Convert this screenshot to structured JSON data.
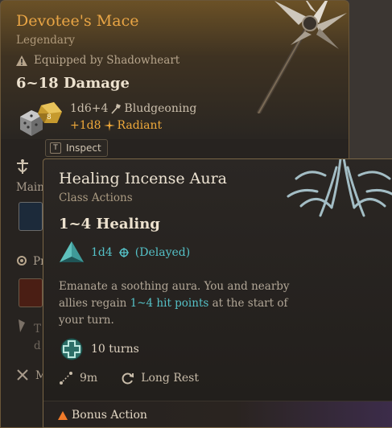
{
  "item": {
    "name": "Devotee's Mace",
    "rarity": "Legendary",
    "equipped_text": "Equipped by Shadowheart",
    "damage_total": "6~18 Damage",
    "damage_rows": [
      {
        "dice": "1d6+4",
        "type": "Bludgeoning"
      },
      {
        "dice": "+1d8",
        "type": "Radiant"
      }
    ],
    "partial_labels": {
      "main": "Main",
      "proficiency": "Pr",
      "t_row": "T",
      "d_row": "d",
      "m_row": "M"
    }
  },
  "inspect": {
    "key": "T",
    "label": "Inspect"
  },
  "spell": {
    "name": "Healing Incense Aura",
    "category": "Class Actions",
    "healing_total": "1~4 Healing",
    "dice": "1d4",
    "timing": "(Delayed)",
    "description": {
      "before": "Emanate a soothing aura. You and nearby allies regain ",
      "highlight": "1~4 hit points",
      "after": " at the start of your turn."
    },
    "duration": "10 turns",
    "range": "9m",
    "recharge": "Long Rest",
    "cost": "Bonus Action"
  },
  "colors": {
    "item_name": "#e9a545",
    "radiant": "#f0a93a",
    "spell_highlight": "#55c1c7",
    "bonus_action": "#f07a2a"
  },
  "icons": [
    "warning-icon",
    "dice-icon",
    "bludgeoning-icon",
    "radiant-icon",
    "mace-art",
    "class-action-icon",
    "spell-rune-icon",
    "d4-icon",
    "delayed-icon",
    "duration-icon",
    "range-icon",
    "recharge-icon",
    "bonus-action-icon",
    "aura-art"
  ]
}
